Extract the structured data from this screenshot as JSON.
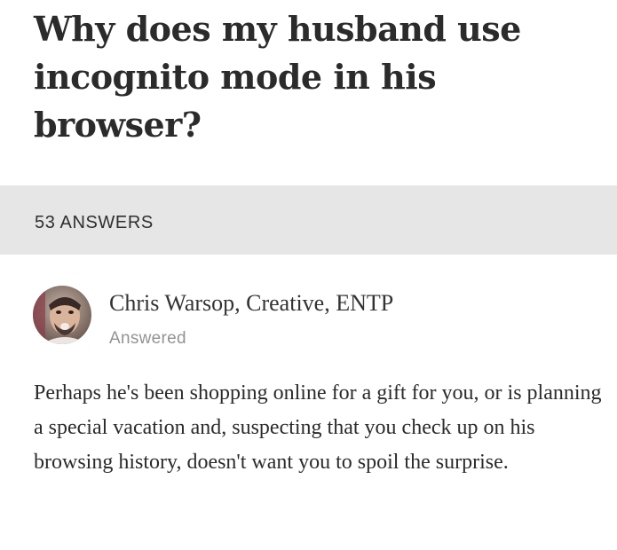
{
  "question": {
    "title": "Why does my husband use incognito mode in his browser?"
  },
  "answers_bar": {
    "count_label": "53 ANSWERS"
  },
  "answer": {
    "author": "Chris Warsop, Creative, ENTP",
    "meta": "Answered",
    "avatar_icon": "user-photo",
    "body": "Perhaps he's been shopping online for a gift for you, or is planning a special vacation and, suspecting that you check up on his browsing history, doesn't want you to spoil the surprise."
  },
  "colors": {
    "text": "#2b2b2b",
    "bar_background": "#e6e6e6",
    "muted": "#939393"
  }
}
